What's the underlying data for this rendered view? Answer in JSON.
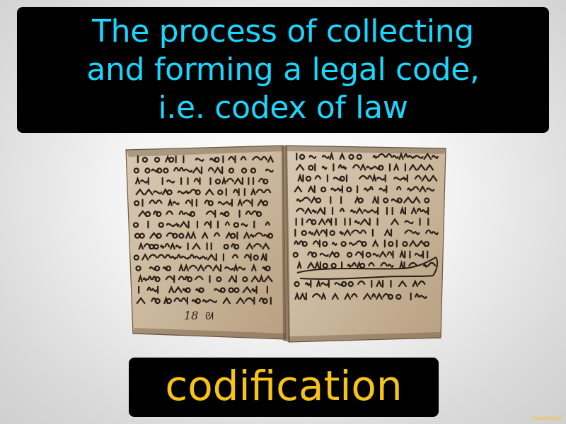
{
  "definition": {
    "text": "The process of collecting\nand forming a legal code,\ni.e. codex of law"
  },
  "term": {
    "label": "codification"
  },
  "brand": {
    "label": "GameSmartz"
  },
  "image": {
    "page_number": "18",
    "colors": {
      "parchment": "#cdbba3",
      "ink": "#2a1e16"
    }
  },
  "colors": {
    "definition_text": "#19d7ff",
    "term_text": "#f7c21a",
    "box_background": "#000000"
  }
}
